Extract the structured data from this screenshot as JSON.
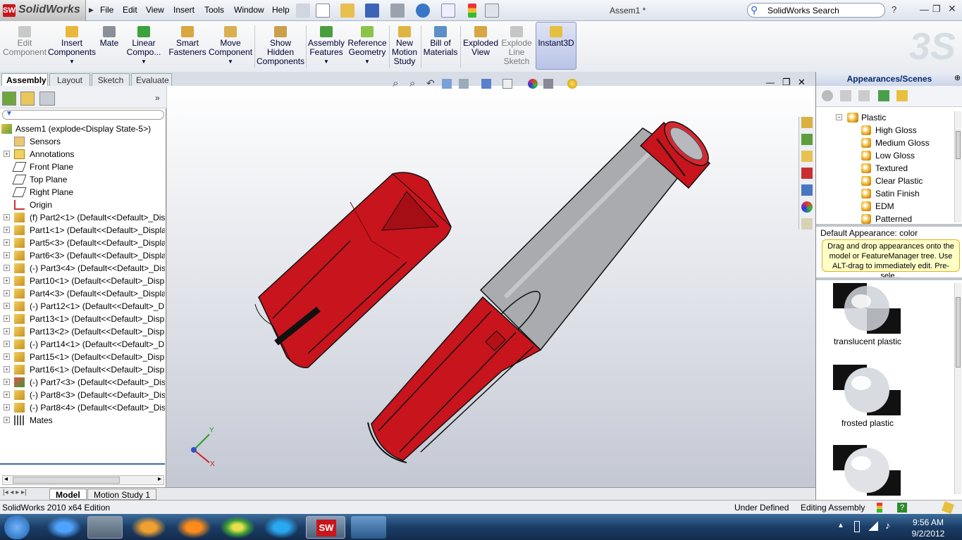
{
  "app": {
    "name": "SolidWorks",
    "logo_text": "SW",
    "doc_title": "Assem1 *",
    "search_placeholder": "SolidWorks Search"
  },
  "menus": [
    "File",
    "Edit",
    "View",
    "Insert",
    "Tools",
    "Window",
    "Help"
  ],
  "ribbon": [
    {
      "label": "Edit Component",
      "lines": [
        "Edit",
        "Component"
      ],
      "disabled": true
    },
    {
      "label": "Insert Components",
      "lines": [
        "Insert",
        "Components"
      ],
      "disabled": false
    },
    {
      "label": "Mate",
      "lines": [
        "Mate"
      ],
      "disabled": false
    },
    {
      "label": "Linear Compo...",
      "lines": [
        "Linear",
        "Compo..."
      ],
      "disabled": false
    },
    {
      "label": "Smart Fasteners",
      "lines": [
        "Smart",
        "Fasteners"
      ],
      "disabled": false
    },
    {
      "label": "Move Component",
      "lines": [
        "Move",
        "Component"
      ],
      "disabled": false
    },
    {
      "label": "Show Hidden Components",
      "lines": [
        "Show",
        "Hidden",
        "Components"
      ],
      "disabled": false
    },
    {
      "label": "Assembly Features",
      "lines": [
        "Assembly",
        "Features"
      ],
      "disabled": false
    },
    {
      "label": "Reference Geometry",
      "lines": [
        "Reference",
        "Geometry"
      ],
      "disabled": false
    },
    {
      "label": "New Motion Study",
      "lines": [
        "New",
        "Motion",
        "Study"
      ],
      "disabled": false
    },
    {
      "label": "Bill of Materials",
      "lines": [
        "Bill of",
        "Materials"
      ],
      "disabled": false
    },
    {
      "label": "Exploded View",
      "lines": [
        "Exploded",
        "View"
      ],
      "disabled": false
    },
    {
      "label": "Explode Line Sketch",
      "lines": [
        "Explode",
        "Line",
        "Sketch"
      ],
      "disabled": true
    },
    {
      "label": "Instant3D",
      "lines": [
        "Instant3D"
      ],
      "disabled": false
    }
  ],
  "tabs": [
    "Assembly",
    "Layout",
    "Sketch",
    "Evaluate"
  ],
  "tree": [
    {
      "label": "Assem1  (explode<Display State-5>)",
      "type": "root"
    },
    {
      "label": "Sensors",
      "type": "sensor"
    },
    {
      "label": "Annotations",
      "type": "annot"
    },
    {
      "label": "Front Plane",
      "type": "plane"
    },
    {
      "label": "Top Plane",
      "type": "plane"
    },
    {
      "label": "Right Plane",
      "type": "plane"
    },
    {
      "label": "Origin",
      "type": "origin"
    },
    {
      "label": "(f) Part2<1> (Default<<Default>_Dis",
      "type": "part"
    },
    {
      "label": "Part1<1> (Default<<Default>_Displa",
      "type": "part"
    },
    {
      "label": "Part5<3> (Default<<Default>_Displa",
      "type": "part"
    },
    {
      "label": "Part6<3> (Default<<Default>_Displa",
      "type": "part"
    },
    {
      "label": "(-) Part3<4> (Default<<Default>_Dis",
      "type": "part"
    },
    {
      "label": "Part10<1> (Default<<Default>_Displ",
      "type": "part"
    },
    {
      "label": "Part4<3> (Default<<Default>_Displa",
      "type": "part"
    },
    {
      "label": "(-) Part12<1> (Default<<Default>_D",
      "type": "part"
    },
    {
      "label": "Part13<1> (Default<<Default>_Displ",
      "type": "part"
    },
    {
      "label": "Part13<2> (Default<<Default>_Displ",
      "type": "part"
    },
    {
      "label": "(-) Part14<1> (Default<<Default>_D",
      "type": "part"
    },
    {
      "label": "Part15<1> (Default<<Default>_Displ",
      "type": "part"
    },
    {
      "label": "Part16<1> (Default<<Default>_Displ",
      "type": "part"
    },
    {
      "label": "(-) Part7<3> (Default<<Default>_Dis",
      "type": "subasm"
    },
    {
      "label": "(-) Part8<3> (Default<<Default>_Dis",
      "type": "part"
    },
    {
      "label": "(-) Part8<4> (Default<<Default>_Dis",
      "type": "part"
    },
    {
      "label": "Mates",
      "type": "mates"
    }
  ],
  "bottom_tabs": [
    "Model",
    "Motion Study 1"
  ],
  "status": {
    "edition": "SolidWorks 2010 x64 Edition",
    "state": "Under Defined",
    "mode": "Editing Assembly"
  },
  "right_panel": {
    "title": "Appearances/Scenes",
    "folder": "Plastic",
    "items": [
      "High Gloss",
      "Medium Gloss",
      "Low Gloss",
      "Textured",
      "Clear Plastic",
      "Satin Finish",
      "EDM",
      "Patterned"
    ],
    "default_appearance": "Default Appearance: color",
    "tip": "Drag and drop appearances onto the model or FeatureManager tree.  Use ALT-drag to immediately edit.  Pre-sele...",
    "swatches": [
      "translucent plastic",
      "frosted plastic",
      ""
    ]
  },
  "triad": {
    "x": "X",
    "y": "Y"
  },
  "clock": {
    "time": "9:56 AM",
    "date": "9/2/2012"
  },
  "colors": {
    "part_red": "#c8141c",
    "ribbon_accent": "#b9c3e6",
    "taskbar": "#1b3d66"
  }
}
